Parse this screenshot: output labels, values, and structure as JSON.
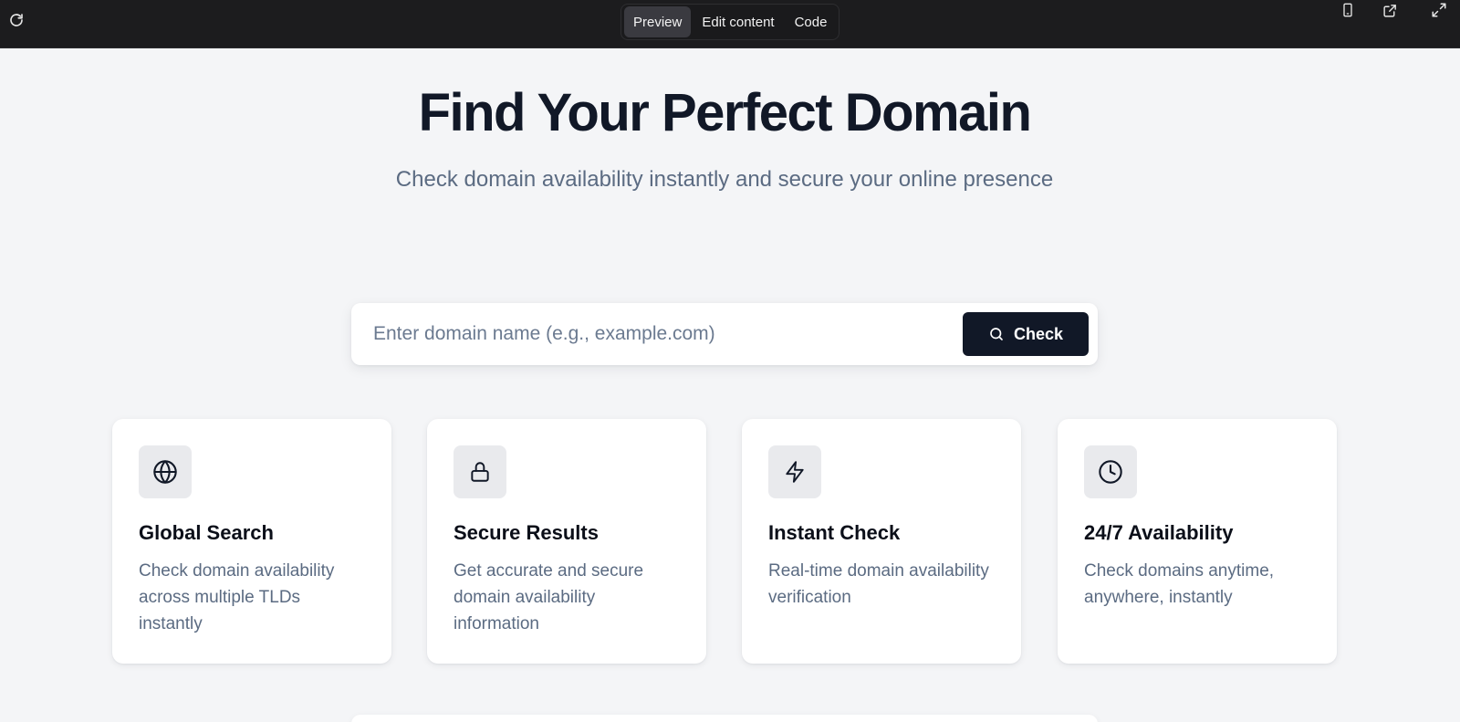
{
  "toolbar": {
    "tabs": [
      {
        "label": "Preview",
        "active": true
      },
      {
        "label": "Edit content",
        "active": false
      },
      {
        "label": "Code",
        "active": false
      }
    ],
    "icons": [
      "reload-icon",
      "mobile-icon",
      "open-external-icon",
      "fullscreen-icon"
    ]
  },
  "hero": {
    "title": "Find Your Perfect Domain",
    "subtitle": "Check domain availability instantly and secure your online presence"
  },
  "search": {
    "placeholder": "Enter domain name (e.g., example.com)",
    "value": "",
    "button_label": "Check"
  },
  "features": [
    {
      "icon": "globe-icon",
      "title": "Global Search",
      "description": "Check domain availability across multiple TLDs instantly"
    },
    {
      "icon": "lock-icon",
      "title": "Secure Results",
      "description": "Get accurate and secure domain availability information"
    },
    {
      "icon": "lightning-icon",
      "title": "Instant Check",
      "description": "Real-time domain availability verification"
    },
    {
      "icon": "clock-icon",
      "title": "24/7 Availability",
      "description": "Check domains anytime, anywhere, instantly"
    }
  ],
  "colors": {
    "toolbar_bg": "#1c1c1e",
    "page_bg": "#f4f5f7",
    "primary": "#111827",
    "muted_text": "#5b6b82"
  }
}
